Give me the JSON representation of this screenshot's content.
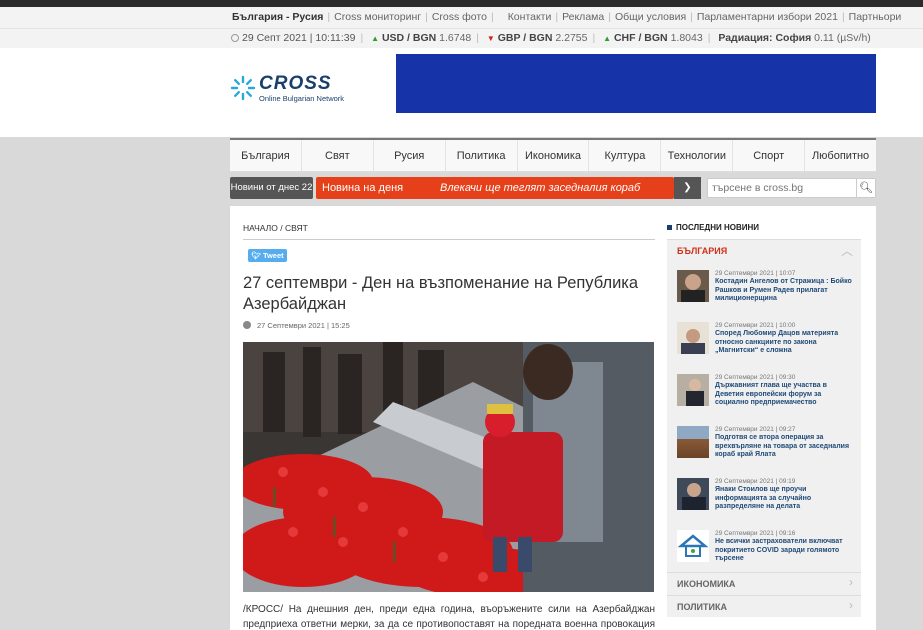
{
  "top_links": {
    "site": "България - Русия",
    "items": [
      "Cross мониторинг",
      "Cross фото",
      "Контакти",
      "Реклама",
      "Общи условия",
      "Парламентарни избори 2021",
      "Партньори"
    ]
  },
  "info_bar": {
    "datetime": "29 Септ 2021 | 10:11:39",
    "rates": [
      {
        "pair": "USD / BGN",
        "value": "1.6748",
        "trend": "up"
      },
      {
        "pair": "GBP / BGN",
        "value": "2.2755",
        "trend": "down"
      },
      {
        "pair": "CHF / BGN",
        "value": "1.8043",
        "trend": "up"
      }
    ],
    "radiation_label": "Радиация: София",
    "radiation_value": "0.11",
    "radiation_unit": "(µSv/h)"
  },
  "logo": {
    "word": "CROSS",
    "tagline": "Online Bulgarian Network"
  },
  "nav": [
    "България",
    "Свят",
    "Русия",
    "Политика",
    "Икономика",
    "Култура",
    "Технологии",
    "Спорт",
    "Любопитно"
  ],
  "ticker": {
    "today": "Новини от днес 22",
    "label": "Новина на деня",
    "headline": "Влекачи ще теглят заседналия кораб",
    "arrow": "❯"
  },
  "search": {
    "placeholder": "търсене в cross.bg"
  },
  "article": {
    "breadcrumb": "НАЧАЛО / СВЯТ",
    "tweet": "Tweet",
    "title": "27 септември - Ден на възпоменание на Република Азербайджан",
    "date": "27 Септември 2021 | 15:25",
    "body": "/КРОСС/ На днешния ден, преди една година, въоръжените сили на Азербайджан предприеха ответни мерки, за да се противопоставят на поредната военна провокация на въоръжените"
  },
  "sidebar": {
    "heading": "ПОСЛЕДНИ НОВИНИ",
    "section": "БЪЛГАРИЯ",
    "chevron_up": "︿",
    "chevron_right": "›",
    "items": [
      {
        "time": "29 Септември 2021 | 10:07",
        "title": "Костадин Ангелов от Стражица : Бойко Рашков и Румен Радев прилагат милиционерщина",
        "thumb": "#6a5a4c"
      },
      {
        "time": "29 Септември 2021 | 10:00",
        "title": "Според Любомир Дацов материята относно санкциите по закона „Магнитски“ е сложна",
        "thumb": "#8a7868"
      },
      {
        "time": "29 Септември 2021 | 09:30",
        "title": "Държавният глава ще участва в Деветия европейски форум за социално предприемачество",
        "thumb": "#a89e8e"
      },
      {
        "time": "29 Септември 2021 | 09:27",
        "title": "Подготвя се втора операция за врехвърляне на товара от заседналия кораб край Ялата",
        "thumb": "#8a5a38"
      },
      {
        "time": "29 Септември 2021 | 09:19",
        "title": "Янаки Стоилов ще проучи информацията за случайно разпределяне на делата",
        "thumb": "#3e4a5a"
      },
      {
        "time": "29 Септември 2021 | 09:16",
        "title": "Не всички застрахователи включват покритието COVID заради голямото търсене",
        "thumb": "#ffffff"
      }
    ],
    "sections_below": [
      "ИКОНОМИКА",
      "ПОЛИТИКА"
    ]
  }
}
